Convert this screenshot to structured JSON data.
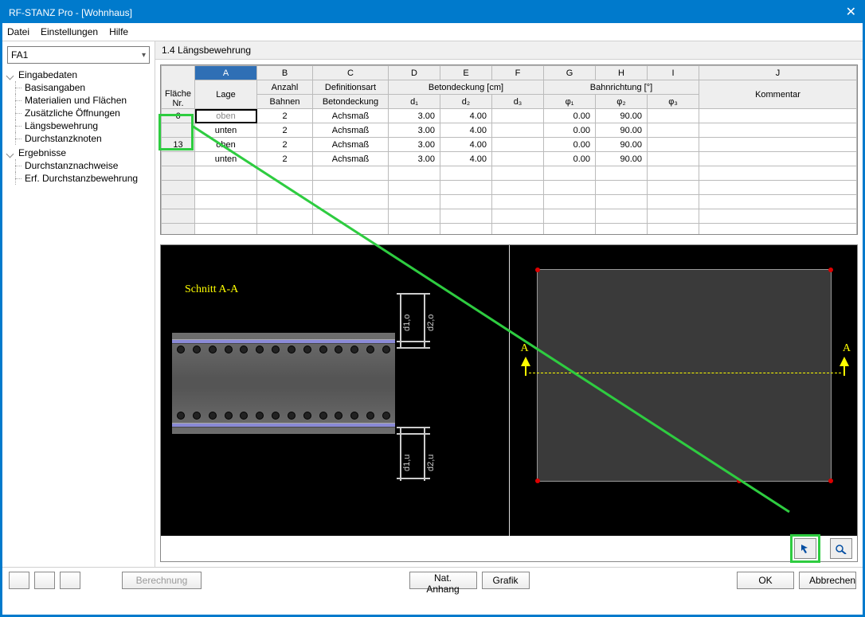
{
  "window": {
    "title": "RF-STANZ Pro - [Wohnhaus]"
  },
  "menubar": {
    "items": [
      "Datei",
      "Einstellungen",
      "Hilfe"
    ]
  },
  "sidebar": {
    "combo_value": "FA1",
    "groups": [
      {
        "label": "Eingabedaten",
        "items": [
          "Basisangaben",
          "Materialien und Flächen",
          "Zusätzliche Öffnungen",
          "Längsbewehrung",
          "Durchstanzknoten"
        ]
      },
      {
        "label": "Ergebnisse",
        "items": [
          "Durchstanznachweise",
          "Erf. Durchstanzbewehrung"
        ]
      }
    ]
  },
  "main": {
    "title": "1.4 Längsbewehrung",
    "letter_cols": [
      "A",
      "B",
      "C",
      "D",
      "E",
      "F",
      "G",
      "H",
      "I",
      "J"
    ],
    "header_row1_left": [
      "Fläche"
    ],
    "header_row2_left": [
      "Nr."
    ],
    "group_beton": "Betondeckung [cm]",
    "group_bahn": "Bahnrichtung [°]",
    "col_labels": {
      "lage": "Lage",
      "bahnen": "Anzahl\nBahnen",
      "defart": "Definitionsart\nBetondeckung",
      "d1": "d₁",
      "d2": "d₂",
      "d3": "d₃",
      "phi1": "φ₁",
      "phi2": "φ₂",
      "phi3": "φ₃",
      "kommentar": "Kommentar"
    },
    "rows": [
      {
        "nr": "6",
        "lage": "oben",
        "bahnen": 2,
        "defart": "Achsmaß",
        "d1": "3.00",
        "d2": "4.00",
        "d3": "",
        "phi1": "0.00",
        "phi2": "90.00",
        "phi3": "",
        "kom": ""
      },
      {
        "nr": "",
        "lage": "unten",
        "bahnen": 2,
        "defart": "Achsmaß",
        "d1": "3.00",
        "d2": "4.00",
        "d3": "",
        "phi1": "0.00",
        "phi2": "90.00",
        "phi3": "",
        "kom": ""
      },
      {
        "nr": "13",
        "lage": "oben",
        "bahnen": 2,
        "defart": "Achsmaß",
        "d1": "3.00",
        "d2": "4.00",
        "d3": "",
        "phi1": "0.00",
        "phi2": "90.00",
        "phi3": "",
        "kom": ""
      },
      {
        "nr": "",
        "lage": "unten",
        "bahnen": 2,
        "defart": "Achsmaß",
        "d1": "3.00",
        "d2": "4.00",
        "d3": "",
        "phi1": "0.00",
        "phi2": "90.00",
        "phi3": "",
        "kom": ""
      }
    ],
    "schnitt_label": "Schnitt A-A",
    "dim_labels": {
      "d1o": "d1,o",
      "d2o": "d2,o",
      "d1u": "d1,u",
      "d2u": "d2,u"
    },
    "A_label": "A",
    "pick_icon": "pick-icon",
    "view_icon": "view-icon"
  },
  "footer": {
    "help_icon": "help-icon",
    "export_icon": "export-icon",
    "import_icon": "import-icon",
    "calc": "Berechnung",
    "nat": "Nat. Anhang",
    "grafik": "Grafik",
    "ok": "OK",
    "cancel": "Abbrechen"
  }
}
